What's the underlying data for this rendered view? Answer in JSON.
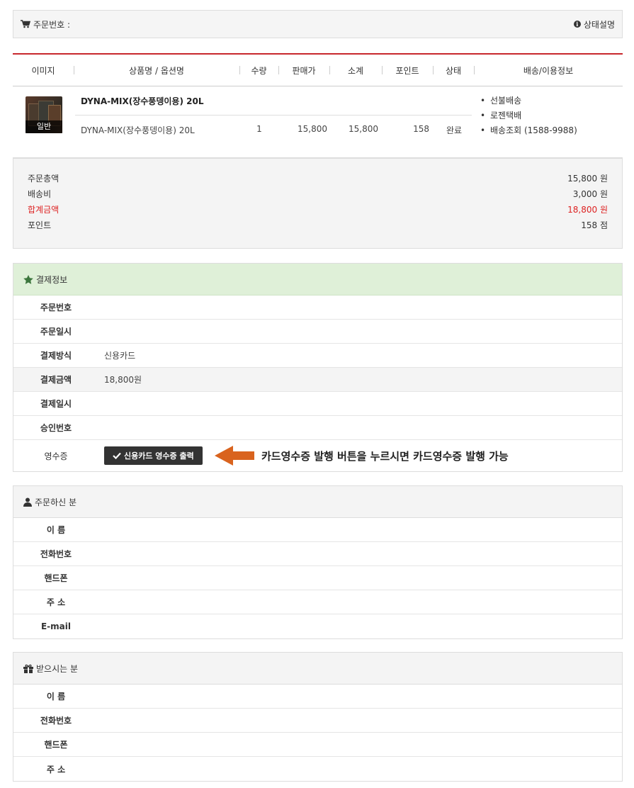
{
  "header": {
    "order_no_label": "주문번호 :",
    "status_help": "상태설명"
  },
  "columns": [
    "이미지",
    "상품명 / 옵션명",
    "수량",
    "판매가",
    "소계",
    "포인트",
    "상태",
    "배송/이용정보"
  ],
  "product": {
    "badge": "일반",
    "name": "DYNA-MIX(장수풍뎅이용) 20L",
    "option": "DYNA-MIX(장수풍뎅이용) 20L",
    "qty": "1",
    "price": "15,800",
    "subtotal": "15,800",
    "point": "158",
    "status": "완료",
    "shipping": [
      "선불배송",
      "로젠택배",
      "배송조회 (1588-9988)"
    ]
  },
  "totals": [
    {
      "label": "주문총액",
      "value": "15,800 원"
    },
    {
      "label": "배송비",
      "value": "3,000 원"
    },
    {
      "label": "합계금액",
      "value": "18,800 원"
    },
    {
      "label": "포인트",
      "value": "158 점"
    }
  ],
  "payment": {
    "title": "결제정보",
    "rows": [
      {
        "label": "주문번호",
        "value": ""
      },
      {
        "label": "주문일시",
        "value": ""
      },
      {
        "label": "결제방식",
        "value": "신용카드"
      },
      {
        "label": "결제금액",
        "value": "18,800원"
      },
      {
        "label": "결제일시",
        "value": ""
      },
      {
        "label": "승인번호",
        "value": ""
      }
    ],
    "receipt_label": "영수증",
    "receipt_button": "신용카드 영수증 출력",
    "note": "카드영수증 발행 버튼을 누르시면 카드영수증 발행 가능"
  },
  "orderer": {
    "title": "주문하신 분",
    "rows": [
      "이 름",
      "전화번호",
      "핸드폰",
      "주 소",
      "E-mail"
    ]
  },
  "receiver": {
    "title": "받으시는 분",
    "rows": [
      "이 름",
      "전화번호",
      "핸드폰",
      "주 소"
    ]
  },
  "colors": {
    "accent_red": "#c8282d",
    "payment_header": "#dff0d8",
    "arrow": "#d9631e"
  },
  "icons": {
    "cart": "cart-icon",
    "info": "info-icon",
    "star": "star-icon",
    "user": "user-icon",
    "gift": "gift-icon",
    "check": "check-icon"
  }
}
